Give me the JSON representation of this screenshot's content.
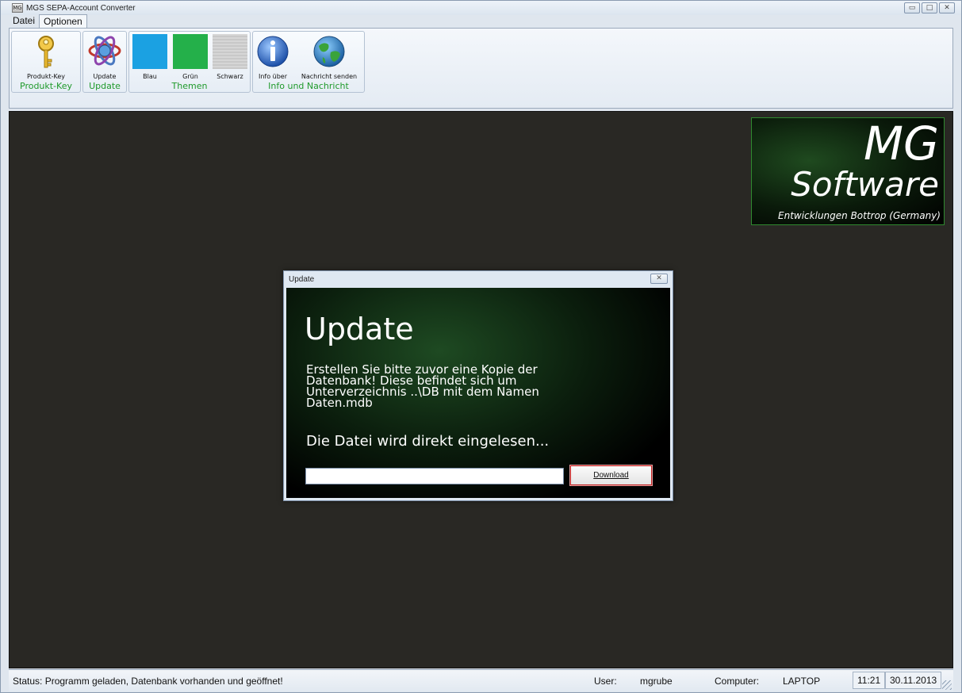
{
  "window": {
    "title": "MGS SEPA-Account Converter",
    "app_icon_text": "MG",
    "controls": {
      "minimize": "▭",
      "maximize": "□",
      "close": "✕"
    }
  },
  "menu": {
    "tabs": [
      {
        "label": "Datei",
        "active": false
      },
      {
        "label": "Optionen",
        "active": true
      }
    ]
  },
  "ribbon": {
    "groups": [
      {
        "label": "Produkt-Key",
        "buttons": [
          {
            "label": "Produkt-Key",
            "icon": "key-icon"
          }
        ]
      },
      {
        "label": "Update",
        "buttons": [
          {
            "label": "Update",
            "icon": "update-atom-icon"
          }
        ]
      },
      {
        "label": "Themen",
        "buttons": [
          {
            "label": "Blau",
            "icon": "blue-swatch",
            "color": "#1ba1e2"
          },
          {
            "label": "Grün",
            "icon": "green-swatch",
            "color": "#24b04a"
          },
          {
            "label": "Schwarz",
            "icon": "gray-swatch",
            "color": "#c8c8c8"
          }
        ]
      },
      {
        "label": "Info und Nachricht",
        "buttons": [
          {
            "label": "Info über",
            "icon": "info-icon"
          },
          {
            "label": "Nachricht senden",
            "icon": "globe-icon"
          }
        ]
      }
    ]
  },
  "logo": {
    "line1": "MG",
    "line2": "Software",
    "line3": "Entwicklungen Bottrop (Germany)"
  },
  "dialog": {
    "title": "Update",
    "close": "✕",
    "heading": "Update",
    "text": "Erstellen Sie bitte zuvor eine Kopie der Datenbank! Diese befindet sich um Unterverzeichnis ..\\DB mit dem Namen Daten.mdb",
    "text2": "Die Datei wird direkt eingelesen...",
    "input_value": "",
    "button_label": "Download"
  },
  "statusbar": {
    "status": "Status: Programm geladen, Datenbank vorhanden und geöffnet!",
    "user_label": "User:",
    "user_value": "mgrube",
    "computer_label": "Computer:",
    "computer_value": "LAPTOP",
    "time": "11:21",
    "date": "30.11.2013"
  },
  "colors": {
    "main_background": "#292824",
    "ribbon_group_label": "#1f9a2b",
    "logo_border": "#2f8a2f"
  }
}
